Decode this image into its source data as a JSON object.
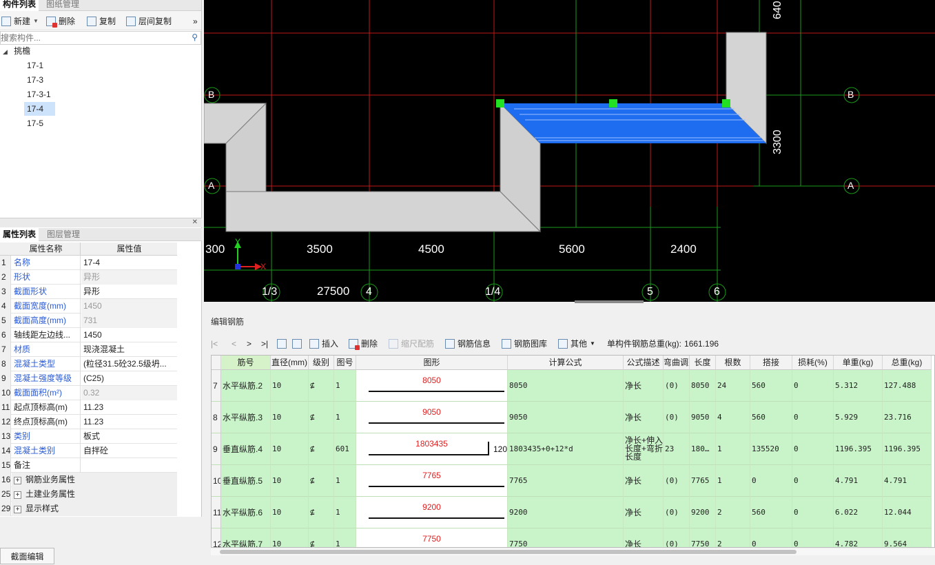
{
  "left_tabs": {
    "components": "构件列表",
    "drawings": "图纸管理"
  },
  "left_toolbar": {
    "new": "新建",
    "delete": "删除",
    "copy": "复制",
    "floor_copy": "层间复制",
    "more": "»"
  },
  "search": {
    "placeholder": "搜索构件..."
  },
  "tree": {
    "root": "挑檐",
    "items": [
      {
        "label": "17-1",
        "selected": false
      },
      {
        "label": "17-3",
        "selected": false
      },
      {
        "label": "17-3-1",
        "selected": false
      },
      {
        "label": "17-4",
        "selected": true
      },
      {
        "label": "17-5",
        "selected": false
      }
    ]
  },
  "prop_tabs": {
    "props": "属性列表",
    "layers": "图层管理"
  },
  "prop_header": {
    "name": "属性名称",
    "value": "属性值"
  },
  "props": [
    {
      "n": "1",
      "name": "名称",
      "value": "17-4",
      "blue": true,
      "gray": false
    },
    {
      "n": "2",
      "name": "形状",
      "value": "异形",
      "blue": true,
      "gray": true
    },
    {
      "n": "3",
      "name": "截面形状",
      "value": "异形",
      "blue": true,
      "gray": false
    },
    {
      "n": "4",
      "name": "截面宽度(mm)",
      "value": "1450",
      "blue": true,
      "gray": true
    },
    {
      "n": "5",
      "name": "截面高度(mm)",
      "value": "731",
      "blue": true,
      "gray": true
    },
    {
      "n": "6",
      "name": "轴线距左边线...",
      "value": "1450",
      "blue": false,
      "gray": false
    },
    {
      "n": "7",
      "name": "材质",
      "value": "现浇混凝土",
      "blue": true,
      "gray": false
    },
    {
      "n": "8",
      "name": "混凝土类型",
      "value": "(粒径31.5砼32.5级坍...",
      "blue": true,
      "gray": false
    },
    {
      "n": "9",
      "name": "混凝土强度等级",
      "value": "(C25)",
      "blue": true,
      "gray": false
    },
    {
      "n": "10",
      "name": "截面面积(m²)",
      "value": "0.32",
      "blue": true,
      "gray": true
    },
    {
      "n": "11",
      "name": "起点顶标高(m)",
      "value": "11.23",
      "blue": false,
      "gray": false
    },
    {
      "n": "12",
      "name": "终点顶标高(m)",
      "value": "11.23",
      "blue": false,
      "gray": false
    },
    {
      "n": "13",
      "name": "类别",
      "value": "板式",
      "blue": true,
      "gray": false
    },
    {
      "n": "14",
      "name": "混凝土类别",
      "value": "自拌砼",
      "blue": true,
      "gray": false
    },
    {
      "n": "15",
      "name": "备注",
      "value": "",
      "blue": false,
      "gray": false
    },
    {
      "n": "16",
      "name": "钢筋业务属性",
      "value": "",
      "group": true
    },
    {
      "n": "25",
      "name": "土建业务属性",
      "value": "",
      "group": true
    },
    {
      "n": "29",
      "name": "显示样式",
      "value": "",
      "group": true
    }
  ],
  "section_edit": "截面编辑",
  "canvas": {
    "axis_labels": {
      "B": "B",
      "A": "A"
    },
    "dims_top": [
      "300",
      "3500",
      "4500",
      "5600",
      "2400"
    ],
    "dims_total": "27500",
    "axis_numbers": [
      "1/3",
      "4",
      "1/4",
      "5",
      "6"
    ],
    "dim_right_1": "640",
    "dim_right_2": "3300",
    "ucs_y": "Y",
    "ucs_x": "X"
  },
  "rebar": {
    "title": "编辑钢筋",
    "nav": [
      "|<",
      "<",
      ">",
      ">|"
    ],
    "insert": "插入",
    "delete": "删除",
    "scale": "缩尺配筋",
    "info": "钢筋信息",
    "lib": "钢筋图库",
    "other": "其他",
    "total_label": "单构件钢筋总重(kg):",
    "total_value": "1661.196",
    "columns": [
      "筋号",
      "直径(mm)",
      "级别",
      "图号",
      "图形",
      "计算公式",
      "公式描述",
      "弯曲调整",
      "长度",
      "根数",
      "搭接",
      "损耗(%)",
      "单重(kg)",
      "总重(kg)"
    ],
    "rows": [
      {
        "idx": "7",
        "name": "水平纵筋.2",
        "dia": "10",
        "grade": "⊈",
        "fig": "1",
        "shape_val": "8050",
        "shape_tail": "",
        "formula": "8050",
        "desc": "净长",
        "bend": "(0)",
        "len": "8050",
        "count": "24",
        "lap": "560",
        "loss": "0",
        "unit": "5.312",
        "total": "127.488"
      },
      {
        "idx": "8",
        "name": "水平纵筋.3",
        "dia": "10",
        "grade": "⊈",
        "fig": "1",
        "shape_val": "9050",
        "shape_tail": "",
        "formula": "9050",
        "desc": "净长",
        "bend": "(0)",
        "len": "9050",
        "count": "4",
        "lap": "560",
        "loss": "0",
        "unit": "5.929",
        "total": "23.716"
      },
      {
        "idx": "9",
        "name": "垂直纵筋.4",
        "dia": "10",
        "grade": "⊈",
        "fig": "601",
        "shape_val": "1803435",
        "shape_tail": "120",
        "formula": "1803435+0+12*d",
        "desc": "净长+伸入长度+弯折长度",
        "bend": "23",
        "len": "180…",
        "count": "1",
        "lap": "135520",
        "loss": "0",
        "unit": "1196.395",
        "total": "1196.395"
      },
      {
        "idx": "10",
        "name": "垂直纵筋.5",
        "dia": "10",
        "grade": "⊈",
        "fig": "1",
        "shape_val": "7765",
        "shape_tail": "",
        "formula": "7765",
        "desc": "净长",
        "bend": "(0)",
        "len": "7765",
        "count": "1",
        "lap": "0",
        "loss": "0",
        "unit": "4.791",
        "total": "4.791"
      },
      {
        "idx": "11",
        "name": "水平纵筋.6",
        "dia": "10",
        "grade": "⊈",
        "fig": "1",
        "shape_val": "9200",
        "shape_tail": "",
        "formula": "9200",
        "desc": "净长",
        "bend": "(0)",
        "len": "9200",
        "count": "2",
        "lap": "560",
        "loss": "0",
        "unit": "6.022",
        "total": "12.044"
      },
      {
        "idx": "12",
        "name": "水平纵筋.7",
        "dia": "10",
        "grade": "⊈",
        "fig": "1",
        "shape_val": "7750",
        "shape_tail": "",
        "formula": "7750",
        "desc": "净长",
        "bend": "(0)",
        "len": "7750",
        "count": "2",
        "lap": "0",
        "loss": "0",
        "unit": "4.782",
        "total": "9.564"
      }
    ]
  }
}
